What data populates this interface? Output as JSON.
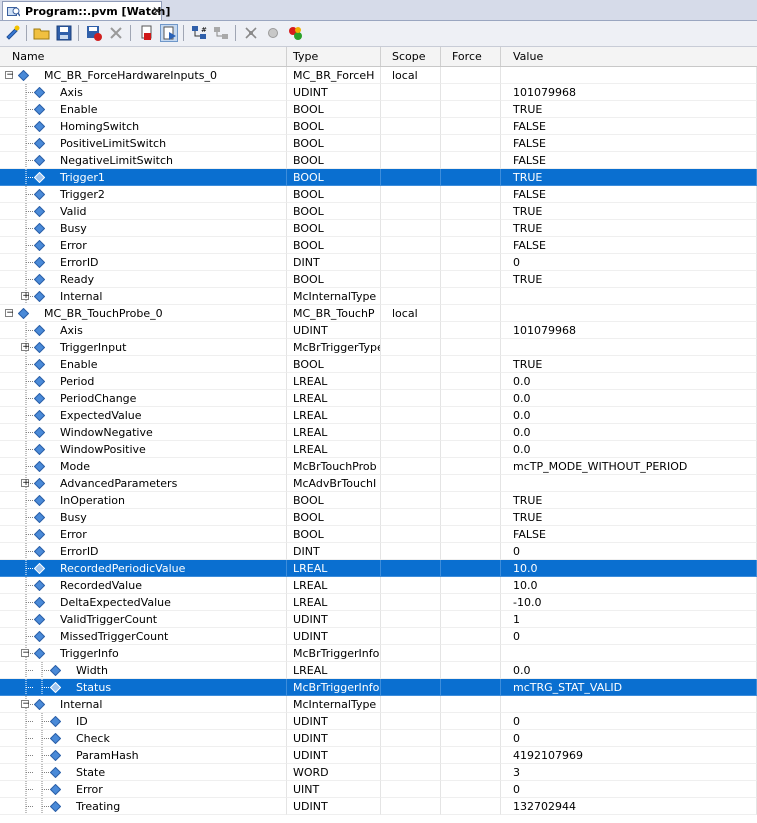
{
  "tab": {
    "title": "Program::.pvm [Watch]",
    "close": "✕"
  },
  "toolbar": {
    "buttons": [
      "add-variable-icon",
      "open-folder-icon",
      "save-icon",
      "save-values-icon",
      "delete-icon",
      "stop-icon",
      "play-icon",
      "tree-icon",
      "force-icon",
      "cut-icon",
      "circle-icon",
      "record-icon"
    ]
  },
  "columns": {
    "name": "Name",
    "type": "Type",
    "scope": "Scope",
    "force": "Force",
    "value": "Value"
  },
  "rows": [
    {
      "name": "MC_BR_ForceHardwareInputs_0",
      "type": "MC_BR_ForceH",
      "scope": "local",
      "value": "",
      "level": 0,
      "expander": "minus",
      "selected": false
    },
    {
      "name": "Axis",
      "type": "UDINT",
      "scope": "",
      "value": "101079968",
      "level": 1,
      "expander": "",
      "selected": false
    },
    {
      "name": "Enable",
      "type": "BOOL",
      "scope": "",
      "value": "TRUE",
      "level": 1,
      "expander": "",
      "selected": false
    },
    {
      "name": "HomingSwitch",
      "type": "BOOL",
      "scope": "",
      "value": "FALSE",
      "level": 1,
      "expander": "",
      "selected": false
    },
    {
      "name": "PositiveLimitSwitch",
      "type": "BOOL",
      "scope": "",
      "value": "FALSE",
      "level": 1,
      "expander": "",
      "selected": false
    },
    {
      "name": "NegativeLimitSwitch",
      "type": "BOOL",
      "scope": "",
      "value": "FALSE",
      "level": 1,
      "expander": "",
      "selected": false
    },
    {
      "name": "Trigger1",
      "type": "BOOL",
      "scope": "",
      "value": "TRUE",
      "level": 1,
      "expander": "",
      "selected": true
    },
    {
      "name": "Trigger2",
      "type": "BOOL",
      "scope": "",
      "value": "FALSE",
      "level": 1,
      "expander": "",
      "selected": false
    },
    {
      "name": "Valid",
      "type": "BOOL",
      "scope": "",
      "value": "TRUE",
      "level": 1,
      "expander": "",
      "selected": false
    },
    {
      "name": "Busy",
      "type": "BOOL",
      "scope": "",
      "value": "TRUE",
      "level": 1,
      "expander": "",
      "selected": false
    },
    {
      "name": "Error",
      "type": "BOOL",
      "scope": "",
      "value": "FALSE",
      "level": 1,
      "expander": "",
      "selected": false
    },
    {
      "name": "ErrorID",
      "type": "DINT",
      "scope": "",
      "value": "0",
      "level": 1,
      "expander": "",
      "selected": false
    },
    {
      "name": "Ready",
      "type": "BOOL",
      "scope": "",
      "value": "TRUE",
      "level": 1,
      "expander": "",
      "selected": false
    },
    {
      "name": "Internal",
      "type": "McInternalType",
      "scope": "",
      "value": "",
      "level": 1,
      "expander": "plus",
      "selected": false
    },
    {
      "name": "MC_BR_TouchProbe_0",
      "type": "MC_BR_TouchP",
      "scope": "local",
      "value": "",
      "level": 0,
      "expander": "minus",
      "selected": false
    },
    {
      "name": "Axis",
      "type": "UDINT",
      "scope": "",
      "value": "101079968",
      "level": 1,
      "expander": "",
      "selected": false
    },
    {
      "name": "TriggerInput",
      "type": "McBrTriggerType",
      "scope": "",
      "value": "",
      "level": 1,
      "expander": "plus",
      "selected": false
    },
    {
      "name": "Enable",
      "type": "BOOL",
      "scope": "",
      "value": "TRUE",
      "level": 1,
      "expander": "",
      "selected": false
    },
    {
      "name": "Period",
      "type": "LREAL",
      "scope": "",
      "value": "0.0",
      "level": 1,
      "expander": "",
      "selected": false
    },
    {
      "name": "PeriodChange",
      "type": "LREAL",
      "scope": "",
      "value": "0.0",
      "level": 1,
      "expander": "",
      "selected": false
    },
    {
      "name": "ExpectedValue",
      "type": "LREAL",
      "scope": "",
      "value": "0.0",
      "level": 1,
      "expander": "",
      "selected": false
    },
    {
      "name": "WindowNegative",
      "type": "LREAL",
      "scope": "",
      "value": "0.0",
      "level": 1,
      "expander": "",
      "selected": false
    },
    {
      "name": "WindowPositive",
      "type": "LREAL",
      "scope": "",
      "value": "0.0",
      "level": 1,
      "expander": "",
      "selected": false
    },
    {
      "name": "Mode",
      "type": "McBrTouchProb",
      "scope": "",
      "value": "mcTP_MODE_WITHOUT_PERIOD",
      "level": 1,
      "expander": "",
      "selected": false
    },
    {
      "name": "AdvancedParameters",
      "type": "McAdvBrTouchI",
      "scope": "",
      "value": "",
      "level": 1,
      "expander": "plus",
      "selected": false
    },
    {
      "name": "InOperation",
      "type": "BOOL",
      "scope": "",
      "value": "TRUE",
      "level": 1,
      "expander": "",
      "selected": false
    },
    {
      "name": "Busy",
      "type": "BOOL",
      "scope": "",
      "value": "TRUE",
      "level": 1,
      "expander": "",
      "selected": false
    },
    {
      "name": "Error",
      "type": "BOOL",
      "scope": "",
      "value": "FALSE",
      "level": 1,
      "expander": "",
      "selected": false
    },
    {
      "name": "ErrorID",
      "type": "DINT",
      "scope": "",
      "value": "0",
      "level": 1,
      "expander": "",
      "selected": false
    },
    {
      "name": "RecordedPeriodicValue",
      "type": "LREAL",
      "scope": "",
      "value": "10.0",
      "level": 1,
      "expander": "",
      "selected": true
    },
    {
      "name": "RecordedValue",
      "type": "LREAL",
      "scope": "",
      "value": "10.0",
      "level": 1,
      "expander": "",
      "selected": false
    },
    {
      "name": "DeltaExpectedValue",
      "type": "LREAL",
      "scope": "",
      "value": "-10.0",
      "level": 1,
      "expander": "",
      "selected": false
    },
    {
      "name": "ValidTriggerCount",
      "type": "UDINT",
      "scope": "",
      "value": "1",
      "level": 1,
      "expander": "",
      "selected": false
    },
    {
      "name": "MissedTriggerCount",
      "type": "UDINT",
      "scope": "",
      "value": "0",
      "level": 1,
      "expander": "",
      "selected": false
    },
    {
      "name": "TriggerInfo",
      "type": "McBrTriggerInfo",
      "scope": "",
      "value": "",
      "level": 1,
      "expander": "minus",
      "selected": false
    },
    {
      "name": "Width",
      "type": "LREAL",
      "scope": "",
      "value": "0.0",
      "level": 2,
      "expander": "",
      "selected": false
    },
    {
      "name": "Status",
      "type": "McBrTriggerInfo",
      "scope": "",
      "value": "mcTRG_STAT_VALID",
      "level": 2,
      "expander": "",
      "selected": true
    },
    {
      "name": "Internal",
      "type": "McInternalType",
      "scope": "",
      "value": "",
      "level": 1,
      "expander": "minus",
      "selected": false
    },
    {
      "name": "ID",
      "type": "UDINT",
      "scope": "",
      "value": "0",
      "level": 2,
      "expander": "",
      "selected": false
    },
    {
      "name": "Check",
      "type": "UDINT",
      "scope": "",
      "value": "0",
      "level": 2,
      "expander": "",
      "selected": false
    },
    {
      "name": "ParamHash",
      "type": "UDINT",
      "scope": "",
      "value": "4192107969",
      "level": 2,
      "expander": "",
      "selected": false
    },
    {
      "name": "State",
      "type": "WORD",
      "scope": "",
      "value": "3",
      "level": 2,
      "expander": "",
      "selected": false
    },
    {
      "name": "Error",
      "type": "UINT",
      "scope": "",
      "value": "0",
      "level": 2,
      "expander": "",
      "selected": false
    },
    {
      "name": "Treating",
      "type": "UDINT",
      "scope": "",
      "value": "132702944",
      "level": 2,
      "expander": "",
      "selected": false
    }
  ]
}
